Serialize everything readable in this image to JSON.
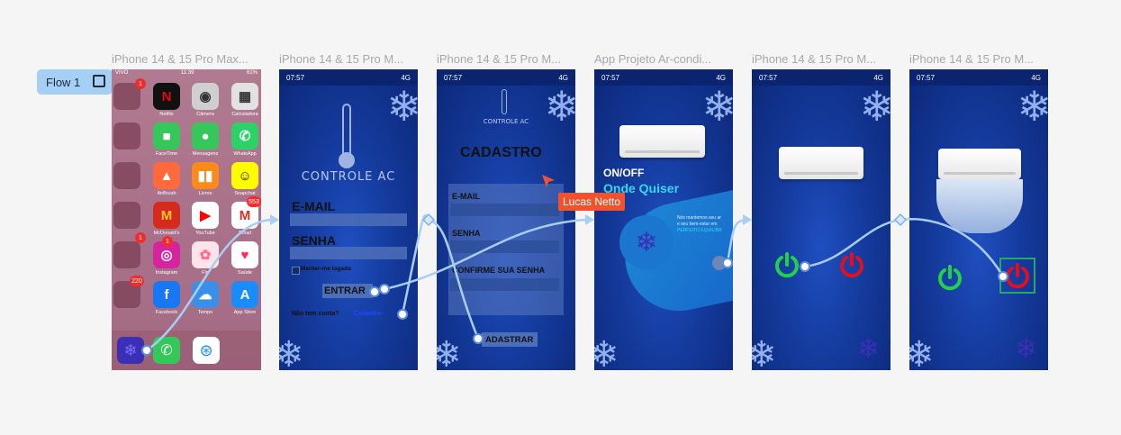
{
  "flow": {
    "label": "Flow 1"
  },
  "frames": [
    {
      "title": "iPhone 14 & 15 Pro Max..."
    },
    {
      "title": "iPhone 14 & 15 Pro M..."
    },
    {
      "title": "iPhone 14 & 15 Pro M..."
    },
    {
      "title": "App Projeto Ar-condi..."
    },
    {
      "title": "iPhone 14 & 15 Pro M..."
    },
    {
      "title": "iPhone 14 & 15 Pro M..."
    }
  ],
  "status": {
    "time": "07:57",
    "signal": "4G",
    "ios_carrier": "VIVO",
    "ios_time": "11:39",
    "ios_battery": "61%"
  },
  "ios": {
    "apps": [
      {
        "name": "Netflix",
        "color": "#111111",
        "glyph": "N",
        "glyph_color": "#e50914"
      },
      {
        "name": "Câmera",
        "color": "#cfcfcf",
        "glyph": "◉",
        "glyph_color": "#333333"
      },
      {
        "name": "Calculadora",
        "color": "#e2e2e2",
        "glyph": "▦",
        "glyph_color": "#333333"
      },
      {
        "name": "FaceTime",
        "color": "#35c759",
        "glyph": "■",
        "glyph_color": "#ffffff"
      },
      {
        "name": "Mensagens",
        "color": "#35c759",
        "glyph": "●",
        "glyph_color": "#ffffff"
      },
      {
        "name": "WhatsApp",
        "color": "#2bd366",
        "glyph": "✆",
        "glyph_color": "#ffffff"
      },
      {
        "name": "AirBrush",
        "color": "#ff6a3d",
        "glyph": "▲",
        "glyph_color": "#ffffff"
      },
      {
        "name": "Livros",
        "color": "#ff8a1c",
        "glyph": "▮▮",
        "glyph_color": "#ffffff"
      },
      {
        "name": "Snapchat",
        "color": "#fffc00",
        "glyph": "☺",
        "glyph_color": "#111111"
      },
      {
        "name": "McDonald's",
        "color": "#d52b1e",
        "glyph": "M",
        "glyph_color": "#ffc72c"
      },
      {
        "name": "YouTube",
        "color": "#ffffff",
        "glyph": "▶",
        "glyph_color": "#ff0000"
      },
      {
        "name": "Email",
        "color": "#ffffff",
        "glyph": "M",
        "glyph_color": "#d93025"
      },
      {
        "name": "Instagram",
        "color": "#d6249f",
        "glyph": "◎",
        "glyph_color": "#ffffff"
      },
      {
        "name": "Flo",
        "color": "#ffe3ea",
        "glyph": "✿",
        "glyph_color": "#ff6b8b"
      },
      {
        "name": "Saúde",
        "color": "#ffffff",
        "glyph": "♥",
        "glyph_color": "#ff2d55"
      },
      {
        "name": "Facebook",
        "color": "#1877f2",
        "glyph": "f",
        "glyph_color": "#ffffff"
      },
      {
        "name": "Tempo",
        "color": "#3b8fe8",
        "glyph": "☁",
        "glyph_color": "#ffffff"
      },
      {
        "name": "App Store",
        "color": "#1a8cff",
        "glyph": "A",
        "glyph_color": "#ffffff"
      }
    ],
    "badges": {
      "folder1": "1",
      "folder4": "1",
      "instagram": "1",
      "folder6": "220",
      "email": "553"
    }
  },
  "login": {
    "brand": "CONTROLE AC",
    "email_label": "E-MAIL",
    "password_label": "SENHA",
    "remember": "Manter-me logado",
    "submit": "ENTRAR",
    "no_account": "Não tem conta?",
    "signup_link": "Cadastre-"
  },
  "signup": {
    "brand": "CONTROLE AC",
    "title": "CADASTRO",
    "email_label": "E-MAIL",
    "password_label": "SENHA",
    "confirm_label": "CONFIRME SUA SENHA",
    "submit": "ADASTRAR"
  },
  "landing": {
    "line1": "ON/OFF",
    "line2": "Onde Quiser",
    "text1": "Nós mantemos seu ar",
    "text2": "e seu bem-estar em",
    "text3": "PERFEITO EQUILÍBR"
  },
  "cursor": {
    "user": "Lucas Netto",
    "color": "#f0522e"
  },
  "colors": {
    "accent": "#a6cff5",
    "flow_line": "#a9cdf3",
    "power_on": "#21d14a",
    "power_off": "#e0101e",
    "selection": "#27a66a"
  }
}
